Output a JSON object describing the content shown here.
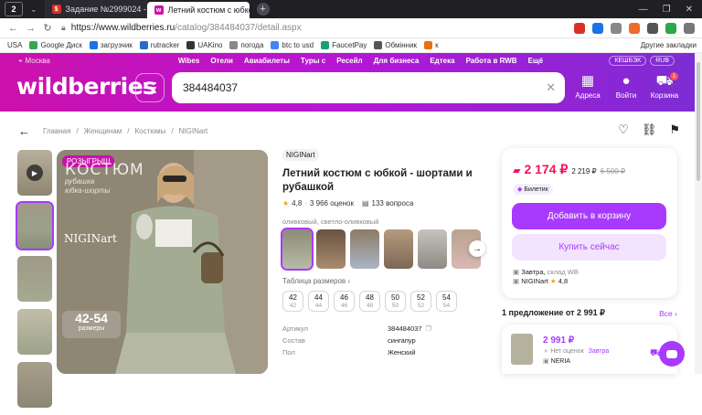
{
  "browser": {
    "profile_badge": "2",
    "tabs": [
      {
        "label": "Задание №2999024 - про",
        "active": false
      },
      {
        "label": "Летний костюм с юбкой",
        "active": true
      }
    ],
    "new_tab": "+",
    "url_host": "https://www.wildberries.ru",
    "url_path": "/catalog/384484037/detail.aspx",
    "bookmarks": [
      "USA",
      "Google Диск",
      "загрузчик",
      "rutracker",
      "UAKino",
      "погода",
      "btc to usd",
      "FaucetPay",
      "Обмінник",
      "к"
    ],
    "bookmarks_other": "Другие закладки"
  },
  "header": {
    "city": "Москва",
    "nav": [
      "Wibes",
      "Отели",
      "Авиабилеты",
      "Туры с",
      "Ресейл",
      "Для бизнеса",
      "Едтека",
      "Работа в RWB",
      "Ещё"
    ],
    "cashback": "КЕШБЭК",
    "currency": "RUB",
    "logo": "wildberries",
    "search_value": "384484037",
    "icons": [
      {
        "glyph": "▦",
        "label": "Адреса"
      },
      {
        "glyph": "●",
        "label": "Войти"
      },
      {
        "glyph": "⛟",
        "label": "Корзина"
      }
    ],
    "cart_count": "1"
  },
  "breadcrumbs": [
    "Главная",
    "Женщинам",
    "Костюмы",
    "NIGINart"
  ],
  "gallery": {
    "promo": "РОЗЫГРЫШ",
    "title": "КОСТЮМ",
    "subtitle_1": "рубашка",
    "subtitle_2": "юбка-шорты",
    "brand_mark": "NIGINart",
    "sizes_range": "42-54",
    "sizes_label": "размеры"
  },
  "product": {
    "brand": "NIGINart",
    "title": "Летний костюм с юбкой - шортами и рубашкой",
    "rating": "4,8",
    "reviews": "3 966 оценок",
    "questions": "133 вопроса",
    "color_label": "оливковый, светло-оливковый",
    "size_table_label": "Таблица размеров",
    "sizes": [
      {
        "ru": "42",
        "intl": "42"
      },
      {
        "ru": "44",
        "intl": "44"
      },
      {
        "ru": "46",
        "intl": "46"
      },
      {
        "ru": "48",
        "intl": "48"
      },
      {
        "ru": "50",
        "intl": "50"
      },
      {
        "ru": "52",
        "intl": "52"
      },
      {
        "ru": "54",
        "intl": "54"
      }
    ],
    "props": [
      {
        "k": "Артикул",
        "v": "384484037"
      },
      {
        "k": "Состав",
        "v": "сингапур"
      },
      {
        "k": "Пол",
        "v": "Женский"
      }
    ]
  },
  "buy_box": {
    "price_wallet": "2 174 ₽",
    "price_card": "2 219 ₽",
    "price_old": "6 500 ₽",
    "chip": "Билетик",
    "add_to_cart": "Добавить в корзину",
    "buy_now": "Купить сейчас",
    "delivery_day": "Завтра,",
    "delivery_from": "склад WB",
    "seller": "NIGINart",
    "seller_rating": "4,8"
  },
  "offers": {
    "heading": "1 предложение от 2 991 ₽",
    "all": "Все",
    "price": "2 991 ₽",
    "no_ratings": "Нет оценок",
    "delivery": "Завтра",
    "seller": "NERIA"
  },
  "colors": {
    "brand_purple": "#a73afd",
    "price_red": "#f91155",
    "header_from": "#cb11ab",
    "header_to": "#7b2dd3"
  }
}
